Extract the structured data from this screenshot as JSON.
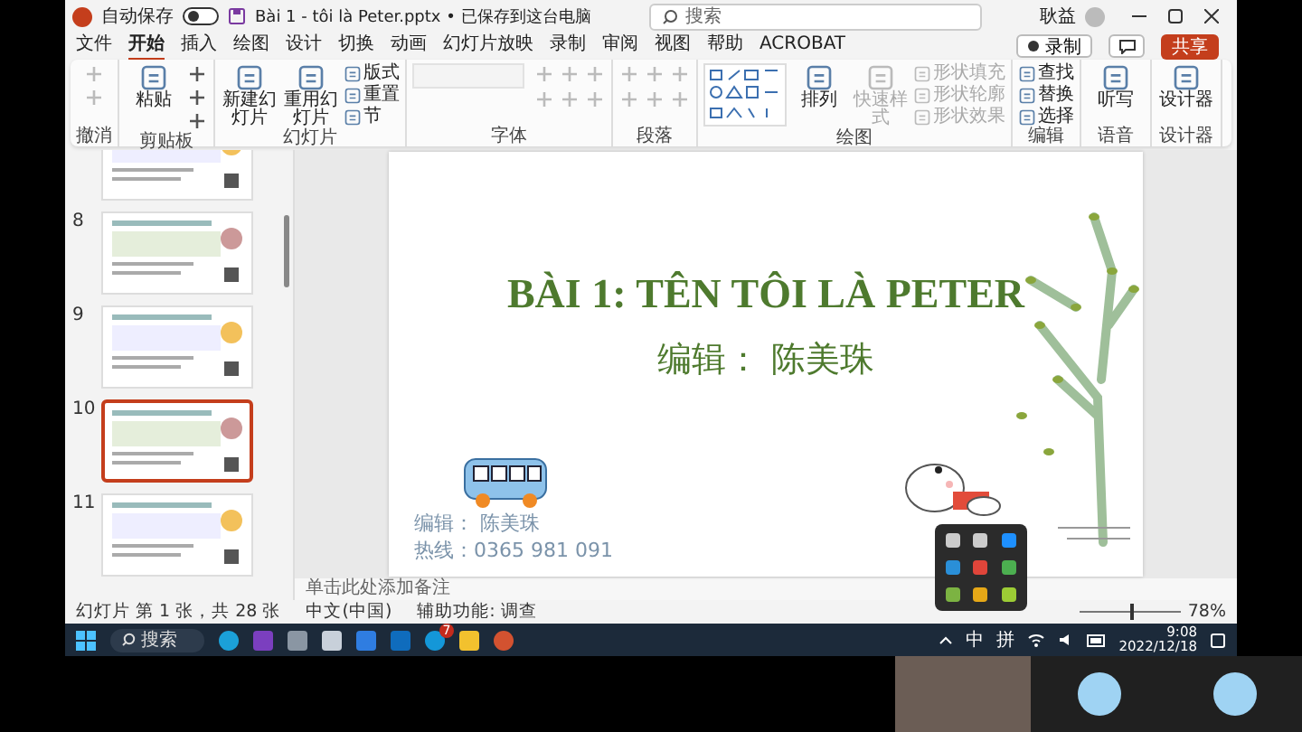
{
  "window": {
    "autosave_label": "自动保存",
    "autosave_on": false,
    "file_title": "Bài 1 - tôi là Peter.pptx • 已保存到这台电脑",
    "search_placeholder": "搜索",
    "user_name": "耿益"
  },
  "menu_tabs": [
    {
      "label": "文件",
      "selected": false
    },
    {
      "label": "开始",
      "selected": true
    },
    {
      "label": "插入",
      "selected": false
    },
    {
      "label": "绘图",
      "selected": false
    },
    {
      "label": "设计",
      "selected": false
    },
    {
      "label": "切换",
      "selected": false
    },
    {
      "label": "动画",
      "selected": false
    },
    {
      "label": "幻灯片放映",
      "selected": false
    },
    {
      "label": "录制",
      "selected": false
    },
    {
      "label": "审阅",
      "selected": false
    },
    {
      "label": "视图",
      "selected": false
    },
    {
      "label": "帮助",
      "selected": false
    },
    {
      "label": "ACROBAT",
      "selected": false
    }
  ],
  "record_button": "录制",
  "share_button": "共享",
  "ribbon_groups": [
    {
      "label": "撤消",
      "items": [
        {
          "kind": "icon",
          "disabled": true
        },
        {
          "kind": "icon",
          "disabled": true
        }
      ]
    },
    {
      "label": "剪贴板",
      "items": [
        {
          "kind": "large",
          "label": "粘贴",
          "disabled": false
        },
        {
          "kind": "icon",
          "disabled": false
        },
        {
          "kind": "icon",
          "disabled": false
        },
        {
          "kind": "icon",
          "disabled": false
        }
      ]
    },
    {
      "label": "幻灯片",
      "items": [
        {
          "kind": "large",
          "label": "新建幻灯片",
          "disabled": false
        },
        {
          "kind": "large",
          "label": "重用幻灯片",
          "disabled": false
        },
        {
          "kind": "small",
          "label": "版式",
          "disabled": false
        },
        {
          "kind": "small",
          "label": "重置",
          "disabled": false
        },
        {
          "kind": "small",
          "label": "节",
          "disabled": false
        }
      ]
    },
    {
      "label": "字体",
      "items": [
        {
          "kind": "field",
          "disabled": true
        },
        {
          "kind": "icon",
          "disabled": true
        },
        {
          "kind": "icon",
          "disabled": true
        },
        {
          "kind": "icon",
          "disabled": true
        },
        {
          "kind": "icon",
          "disabled": true
        },
        {
          "kind": "icon",
          "disabled": true
        },
        {
          "kind": "icon",
          "disabled": true
        }
      ]
    },
    {
      "label": "段落",
      "items": [
        {
          "kind": "icon",
          "disabled": true
        },
        {
          "kind": "icon",
          "disabled": true
        },
        {
          "kind": "icon",
          "disabled": true
        },
        {
          "kind": "icon",
          "disabled": true
        },
        {
          "kind": "icon",
          "disabled": true
        },
        {
          "kind": "icon",
          "disabled": true
        }
      ]
    },
    {
      "label": "绘图",
      "items": [
        {
          "kind": "gallery",
          "disabled": false
        },
        {
          "kind": "large",
          "label": "排列",
          "disabled": false
        },
        {
          "kind": "large",
          "label": "快速样式",
          "disabled": true
        },
        {
          "kind": "small",
          "label": "形状填充",
          "disabled": true
        },
        {
          "kind": "small",
          "label": "形状轮廓",
          "disabled": true
        },
        {
          "kind": "small",
          "label": "形状效果",
          "disabled": true
        }
      ]
    },
    {
      "label": "编辑",
      "items": [
        {
          "kind": "small",
          "label": "查找",
          "disabled": false
        },
        {
          "kind": "small",
          "label": "替换",
          "disabled": false
        },
        {
          "kind": "small",
          "label": "选择",
          "disabled": false
        }
      ]
    },
    {
      "label": "语音",
      "items": [
        {
          "kind": "large",
          "label": "听写",
          "disabled": false
        }
      ]
    },
    {
      "label": "设计器",
      "items": [
        {
          "kind": "large",
          "label": "设计器",
          "disabled": false
        }
      ]
    }
  ],
  "thumbnails": [
    {
      "selected": false
    },
    {
      "number": "8",
      "selected": false
    },
    {
      "number": "9",
      "selected": false
    },
    {
      "number": "10",
      "selected": true
    },
    {
      "number": "11",
      "selected": false
    }
  ],
  "slide": {
    "title": "BÀI 1: TÊN TÔI LÀ PETER",
    "subtitle": "编辑：  陈美珠",
    "footer_editor": "编辑：  陈美珠",
    "footer_hotline": "热线：0365 981 091"
  },
  "notes_placeholder": "单击此处添加备注",
  "status_bar": {
    "slide_count": "幻灯片 第 1 张，共 28 张",
    "language": "中文(中国)",
    "accessibility": "辅助功能: 调查",
    "zoom": {
      "level": 0.5,
      "reading": "78%"
    }
  },
  "taskbar": {
    "search": "搜索",
    "badge": "7",
    "ime_mode": "中",
    "ime_layout": "拼",
    "time": "9:08",
    "date": "2022/12/18"
  }
}
